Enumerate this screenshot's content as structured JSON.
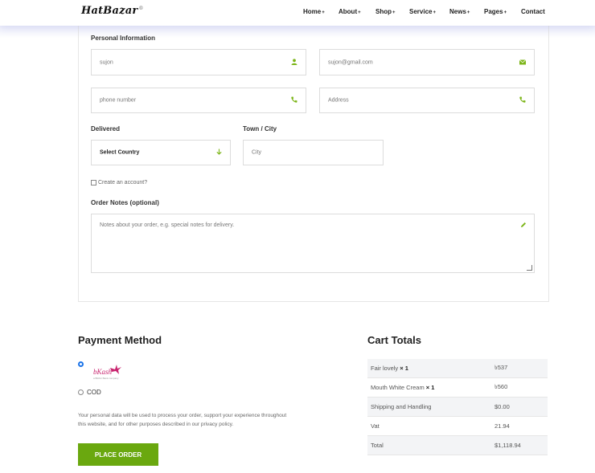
{
  "brand": {
    "logo": "HatBazar",
    "mark": "®"
  },
  "nav": [
    {
      "label": "Home",
      "caret": "+"
    },
    {
      "label": "About",
      "caret": "+"
    },
    {
      "label": "Shop",
      "caret": "+"
    },
    {
      "label": "Service",
      "caret": "+"
    },
    {
      "label": "News",
      "caret": "+"
    },
    {
      "label": "Pages",
      "caret": "+"
    },
    {
      "label": "Contact",
      "caret": ""
    }
  ],
  "form": {
    "section_title": "Personal Information",
    "name_value": "sujon",
    "email_value": "sujon@gmail.com",
    "phone_placeholder": "phone number",
    "address_placeholder": "Address",
    "delivered_label": "Delivered",
    "country_value": "Select Country",
    "town_label": "Town / City",
    "city_placeholder": "City",
    "create_account": "Create an account?",
    "notes_label": "Order Notes (optional)",
    "notes_placeholder": "Notes about your order, e.g. special notes for delivery."
  },
  "payment": {
    "title": "Payment Method",
    "bkash_text": "bKash",
    "bkash_sub": "a BRAC Bank company",
    "cod_label": "COD",
    "privacy_note": "Your personal data will be used to process your order, support your experience throughout this website, and for other purposes described in our privacy policy.",
    "place_order": "PLACE ORDER"
  },
  "cart": {
    "title": "Cart Totals",
    "rows": [
      {
        "label": "Fair lovely",
        "qty": "× 1",
        "value": "৳537"
      },
      {
        "label": "Mouth White Cream",
        "qty": "× 1",
        "value": "৳560"
      },
      {
        "label": "Shipping and Handling",
        "qty": "",
        "value": "$0.00"
      },
      {
        "label": "Vat",
        "qty": "",
        "value": "21.94"
      },
      {
        "label": "Total",
        "qty": "",
        "value": "$1,118.94"
      }
    ]
  },
  "colors": {
    "accent": "#6aa80f",
    "icon": "#7cb518",
    "radio": "#1a73e8"
  }
}
